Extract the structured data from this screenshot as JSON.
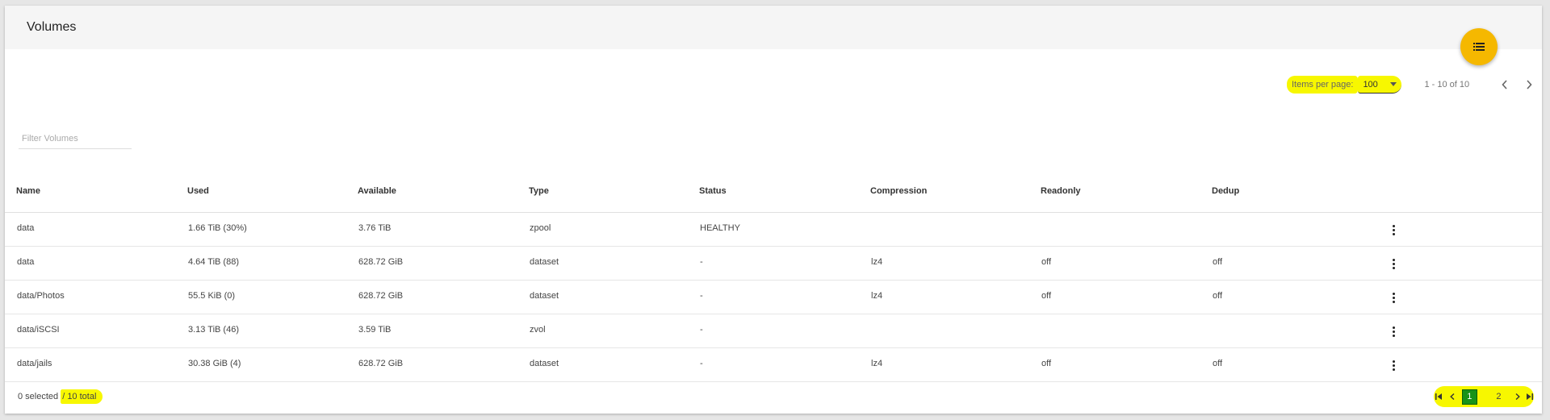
{
  "page": {
    "title": "Volumes"
  },
  "fab": {
    "icon": "list-icon",
    "color": "#f5b800"
  },
  "paginator": {
    "items_per_page_label": "Items per page:",
    "items_per_page_value": "100",
    "range_label": "1 - 10 of 10"
  },
  "filter": {
    "placeholder": "Filter Volumes"
  },
  "table": {
    "columns": [
      "Name",
      "Used",
      "Available",
      "Type",
      "Status",
      "Compression",
      "Readonly",
      "Dedup"
    ],
    "rows": [
      [
        "data",
        "1.66 TiB (30%)",
        "3.76 TiB",
        "zpool",
        "HEALTHY",
        "",
        "",
        ""
      ],
      [
        "data",
        "4.64 TiB (88)",
        "628.72 GiB",
        "dataset",
        "-",
        "lz4",
        "off",
        "off"
      ],
      [
        "data/Photos",
        "55.5 KiB (0)",
        "628.72 GiB",
        "dataset",
        "-",
        "lz4",
        "off",
        "off"
      ],
      [
        "data/iSCSI",
        "3.13 TiB (46)",
        "3.59 TiB",
        "zvol",
        "-",
        "",
        "",
        ""
      ],
      [
        "data/jails",
        "30.38 GiB (4)",
        "628.72 GiB",
        "dataset",
        "-",
        "lz4",
        "off",
        "off"
      ]
    ]
  },
  "footer": {
    "selected": "0 selected ",
    "total": "/ 10 total",
    "pages": [
      "1",
      "2"
    ],
    "current_page": "1"
  },
  "colors": {
    "highlight": "#f7f700",
    "current_page": "#189318",
    "header_bg": "#f5f5f5"
  }
}
